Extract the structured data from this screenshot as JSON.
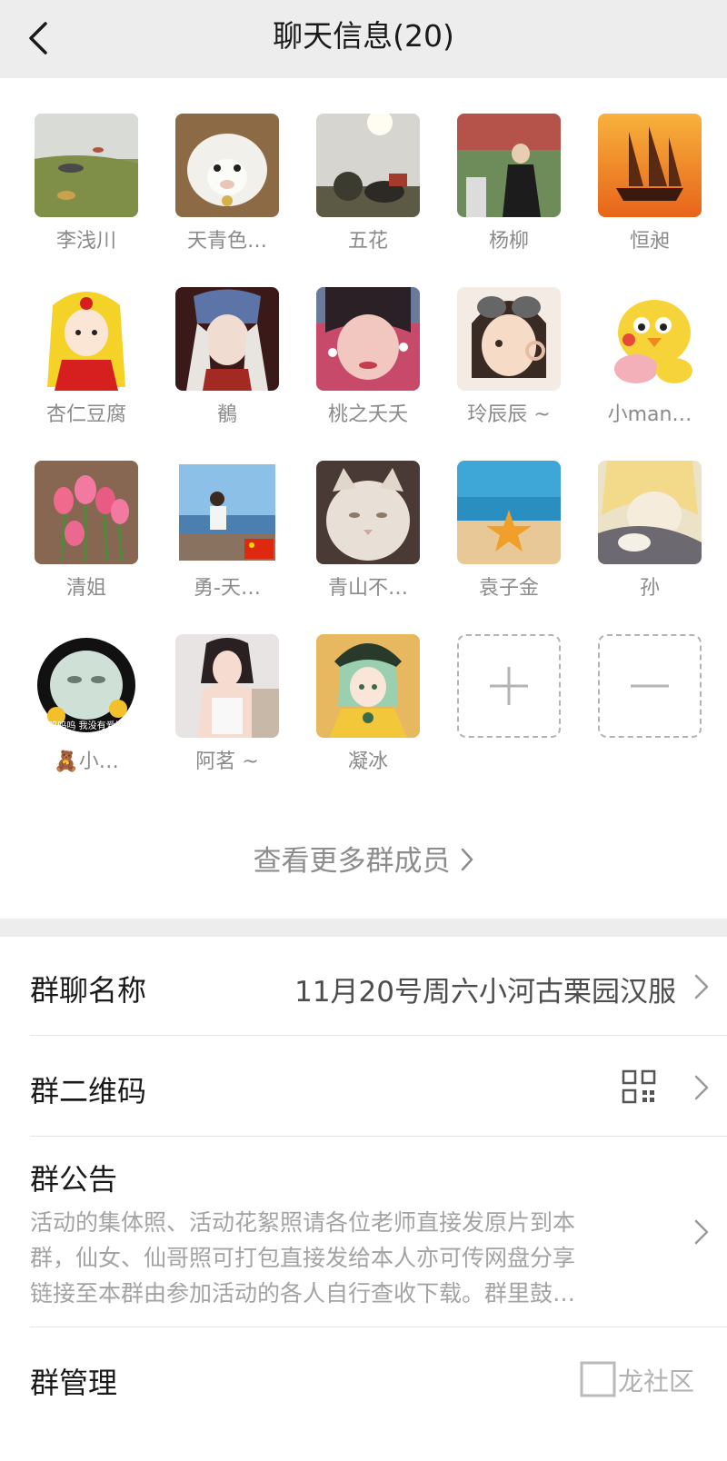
{
  "header": {
    "title": "聊天信息(20)",
    "back_icon": "chevron-left-icon"
  },
  "members": [
    {
      "name": "李浅川",
      "avatar": "meadow-photo"
    },
    {
      "name": "天青色…",
      "avatar": "white-sheep-photo"
    },
    {
      "name": "五花",
      "avatar": "horse-rider-photo"
    },
    {
      "name": "杨柳",
      "avatar": "woman-garden-photo"
    },
    {
      "name": "恒昶",
      "avatar": "sailing-ship-sunset"
    },
    {
      "name": "杏仁豆腐",
      "avatar": "sailor-venus-cartoon"
    },
    {
      "name": "鶺",
      "avatar": "fantasy-girl-art"
    },
    {
      "name": "桃之夭夭",
      "avatar": "girl-selfie-photo"
    },
    {
      "name": "玲辰辰 ~",
      "avatar": "aviator-girl-drawing"
    },
    {
      "name": "小man…",
      "avatar": "yellow-chick-cartoon"
    },
    {
      "name": "清姐",
      "avatar": "pink-tulips-photo"
    },
    {
      "name": "勇-天…",
      "avatar": "man-seaside-photo"
    },
    {
      "name": "青山不…",
      "avatar": "white-cat-photo"
    },
    {
      "name": "袁子金",
      "avatar": "starfish-beach-photo"
    },
    {
      "name": "孙",
      "avatar": "anime-boy-art"
    },
    {
      "name": "🧸小…",
      "avatar": "panda-meme",
      "meme_text": "呜呜呜 我没有爱情"
    },
    {
      "name": "阿茗 ~",
      "avatar": "girl-portrait-photo"
    },
    {
      "name": "凝冰",
      "avatar": "anime-witch-art"
    }
  ],
  "add_member_icon": "plus-icon",
  "remove_member_icon": "minus-icon",
  "more_members_label": "查看更多群成员",
  "settings": {
    "group_name": {
      "label": "群聊名称",
      "value": "11月20号周六小河古栗园汉服"
    },
    "qr_code": {
      "label": "群二维码",
      "icon": "qr-code-icon"
    },
    "notice": {
      "label": "群公告",
      "lines": [
        "活动的集体照、活动花絮照请各位老师直接发原片到本",
        "群，仙女、仙哥照可打包直接发给本人亦可传网盘分享",
        "链接至本群由参加活动的各人自行查收下载。群里鼓…"
      ]
    },
    "manage": {
      "label": "群管理"
    }
  },
  "watermark": "龙社区",
  "colors": {
    "header_bg": "#ededed",
    "name_gray": "#8a8a8a",
    "label_dark": "#1a1a1a"
  }
}
